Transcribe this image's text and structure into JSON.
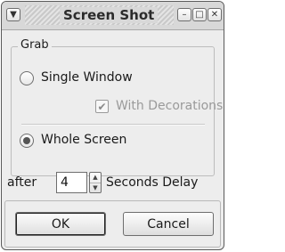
{
  "window": {
    "title": "Screen Shot",
    "menu_icon": "chevron-down-icon",
    "minimize_icon": "minimize-icon",
    "maximize_icon": "maximize-icon",
    "close_icon": "close-icon"
  },
  "grab": {
    "title": "Grab",
    "options": [
      {
        "label": "Single Window",
        "selected": false
      },
      {
        "label": "Whole Screen",
        "selected": true
      }
    ],
    "decorations": {
      "label": "With Decorations",
      "checked": true,
      "enabled": false
    }
  },
  "delay": {
    "prefix": "after",
    "value": "4",
    "suffix": "Seconds Delay"
  },
  "buttons": {
    "ok": "OK",
    "cancel": "Cancel"
  },
  "colors": {
    "window_bg": "#ededed",
    "titlebar_bg": "#d8d8d8",
    "border": "#6e6e6e",
    "disabled_text": "#9a9a9a"
  }
}
